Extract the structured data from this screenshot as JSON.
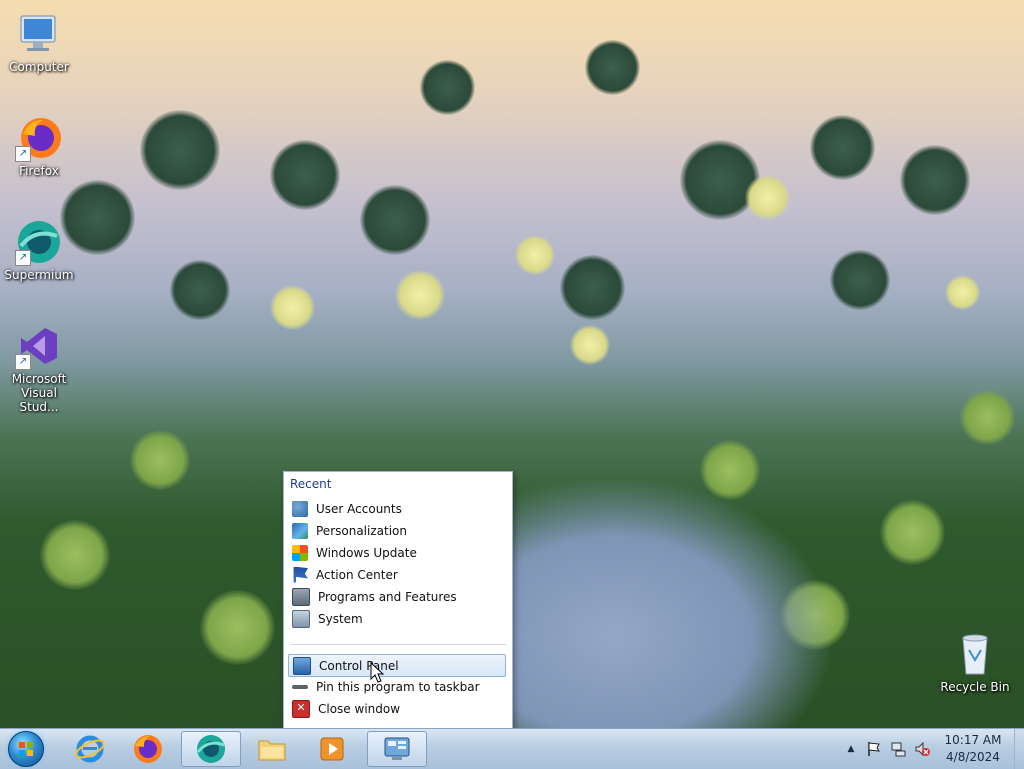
{
  "desktop": {
    "icons": [
      {
        "label": "Computer",
        "icon": "computer-icon"
      },
      {
        "label": "Firefox",
        "icon": "firefox-icon"
      },
      {
        "label": "Supermium",
        "icon": "supermium-icon"
      },
      {
        "label": "Microsoft Visual Stud...",
        "icon": "visual-studio-icon"
      },
      {
        "label": "Recycle Bin",
        "icon": "recycle-bin-icon"
      }
    ]
  },
  "jumplist": {
    "section_title": "Recent",
    "recent_items": [
      {
        "label": "User Accounts",
        "icon": "user-accounts-icon"
      },
      {
        "label": "Personalization",
        "icon": "personalization-icon"
      },
      {
        "label": "Windows Update",
        "icon": "windows-update-icon"
      },
      {
        "label": "Action Center",
        "icon": "action-center-flag-icon"
      },
      {
        "label": "Programs and Features",
        "icon": "programs-features-icon"
      },
      {
        "label": "System",
        "icon": "system-icon"
      }
    ],
    "tasks": [
      {
        "label": "Control Panel",
        "icon": "control-panel-icon"
      },
      {
        "label": "Pin this program to taskbar",
        "icon": "pin-icon"
      },
      {
        "label": "Close window",
        "icon": "close-window-icon"
      }
    ]
  },
  "taskbar": {
    "pinned": [
      {
        "name": "internet-explorer",
        "icon": "internet-explorer-icon"
      },
      {
        "name": "firefox",
        "icon": "firefox-icon"
      },
      {
        "name": "supermium",
        "icon": "supermium-icon"
      },
      {
        "name": "file-explorer",
        "icon": "folder-icon"
      },
      {
        "name": "media-player",
        "icon": "media-player-icon"
      },
      {
        "name": "control-panel",
        "icon": "control-panel-icon"
      }
    ],
    "tray_arrow": "▲",
    "clock": {
      "time": "10:17 AM",
      "date": "4/8/2024"
    }
  },
  "colors": {
    "taskbar": "#b8cde2",
    "jumplist_heading": "#1e3d8f",
    "highlight_border": "#8fb3e1"
  }
}
